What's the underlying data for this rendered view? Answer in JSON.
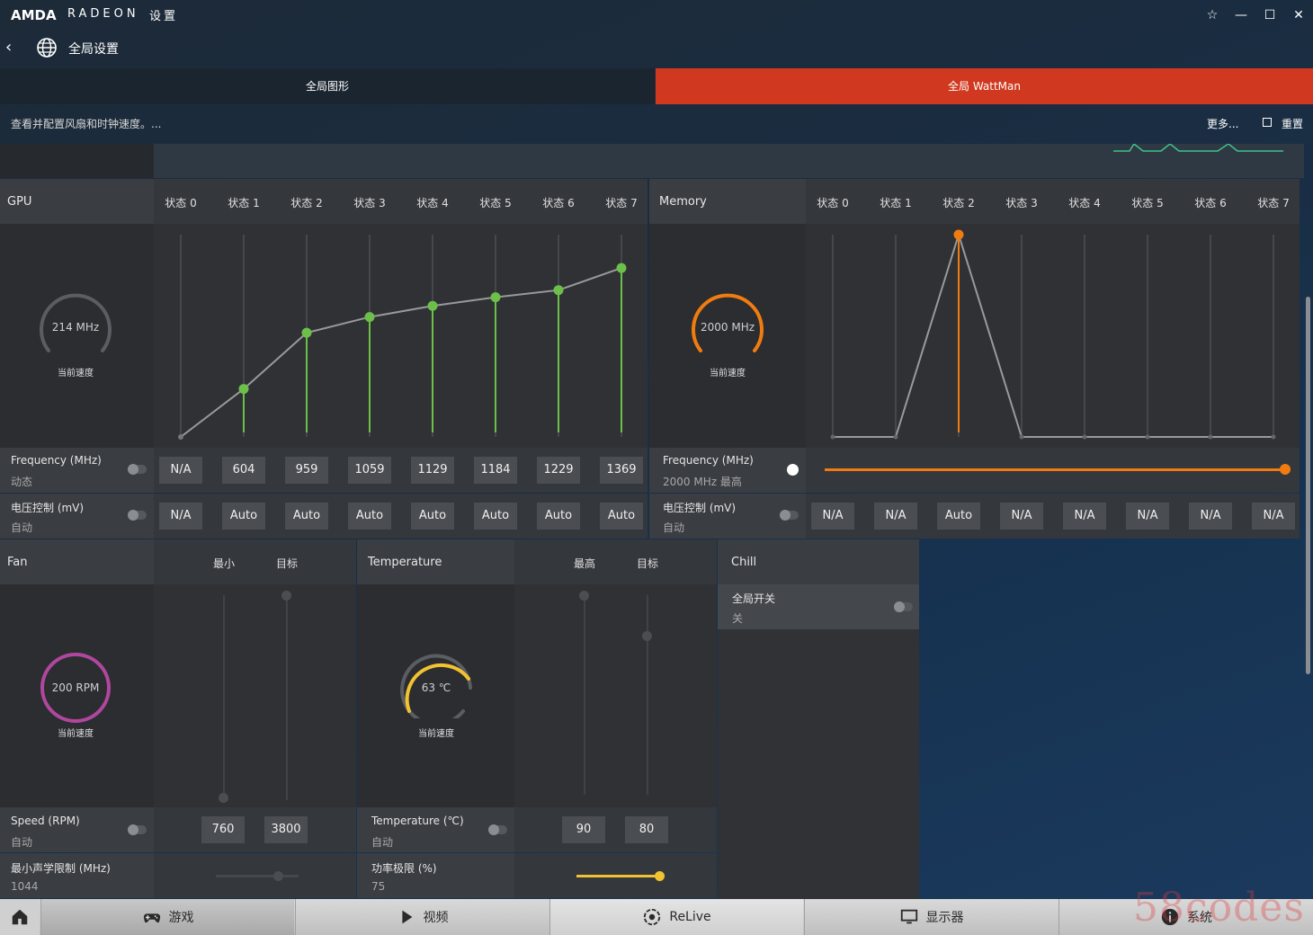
{
  "app": {
    "brand_amd": "AMDA",
    "brand_radeon": "RADEON",
    "brand_settings": "设置"
  },
  "header": {
    "title": "全局设置"
  },
  "tabs": [
    {
      "label": "全局图形"
    },
    {
      "label": "全局 WattMan"
    }
  ],
  "toolbar": {
    "description": "查看并配置风扇和时钟速度。...",
    "more": "更多...",
    "reset": "重置"
  },
  "gpu": {
    "title": "GPU",
    "states": [
      "状态 0",
      "状态 1",
      "状态 2",
      "状态 3",
      "状态 4",
      "状态 5",
      "状态 6",
      "状态 7"
    ],
    "gauge_value": "214 MHz",
    "gauge_caption": "当前速度",
    "frequency_title": "Frequency (MHz)",
    "frequency_sub": "动态",
    "frequencies": [
      "N/A",
      "604",
      "959",
      "1059",
      "1129",
      "1184",
      "1229",
      "1369"
    ],
    "voltage_title": "电压控制 (mV)",
    "voltage_sub": "自动",
    "voltages": [
      "N/A",
      "Auto",
      "Auto",
      "Auto",
      "Auto",
      "Auto",
      "Auto",
      "Auto"
    ]
  },
  "memory": {
    "title": "Memory",
    "states": [
      "状态 0",
      "状态 1",
      "状态 2",
      "状态 3",
      "状态 4",
      "状态 5",
      "状态 6",
      "状态 7"
    ],
    "gauge_value": "2000 MHz",
    "gauge_caption": "当前速度",
    "frequency_title": "Frequency (MHz)",
    "frequency_sub": "2000 MHz 最高",
    "voltage_title": "电压控制 (mV)",
    "voltage_sub": "自动",
    "voltages": [
      "N/A",
      "N/A",
      "Auto",
      "N/A",
      "N/A",
      "N/A",
      "N/A",
      "N/A"
    ]
  },
  "fan": {
    "title": "Fan",
    "col_min": "最小",
    "col_target": "目标",
    "gauge_value": "200 RPM",
    "gauge_caption": "当前速度",
    "speed_title": "Speed (RPM)",
    "speed_sub": "自动",
    "speed_min": "760",
    "speed_target": "3800",
    "acoustic_title": "最小声学限制 (MHz)",
    "acoustic_value": "1044"
  },
  "temperature": {
    "title": "Temperature",
    "col_max": "最高",
    "col_target": "目标",
    "gauge_value": "63 ℃",
    "gauge_caption": "当前速度",
    "temp_title": "Temperature (℃)",
    "temp_sub": "自动",
    "temp_max": "90",
    "temp_target": "80",
    "power_title": "功率极限 (%)",
    "power_value": "75"
  },
  "chill": {
    "title": "Chill",
    "global_switch": "全局开关",
    "global_switch_state": "关"
  },
  "nav": [
    {
      "label": "游戏"
    },
    {
      "label": "视频"
    },
    {
      "label": "ReLive"
    },
    {
      "label": "显示器"
    },
    {
      "label": "系统"
    }
  ],
  "watermark": "58codes",
  "colors": {
    "accent": "#d0391f",
    "gpu_green": "#6cc04a",
    "memory_orange": "#f07c10",
    "fan_purple": "#b0479e",
    "temp_yellow": "#f2c230"
  }
}
